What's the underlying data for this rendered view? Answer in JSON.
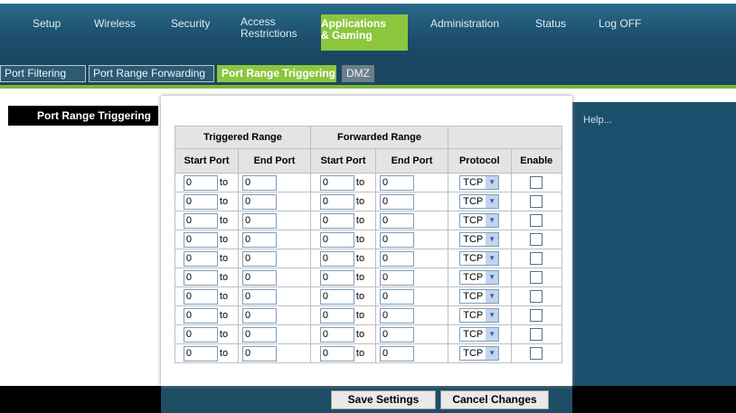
{
  "topnav": {
    "setup": "Setup",
    "wireless": "Wireless",
    "security": "Security",
    "access_line1": "Access",
    "access_line2": "Restrictions",
    "apps_line1": "Applications",
    "apps_line2": "& Gaming",
    "administration": "Administration",
    "status": "Status",
    "logoff": "Log OFF"
  },
  "subtabs": {
    "port_filtering": "Port Filtering",
    "port_range_forwarding": "Port Range Forwarding",
    "port_range_triggering": "Port Range Triggering",
    "dmz": "DMZ"
  },
  "left_header": "Port Range Triggering",
  "help_label": "Help...",
  "table": {
    "group_triggered": "Triggered Range",
    "group_forwarded": "Forwarded Range",
    "col_start": "Start Port",
    "col_end": "End Port",
    "col_protocol": "Protocol",
    "col_enable": "Enable",
    "to_label": "to",
    "rows": [
      {
        "t_start": "0",
        "t_end": "0",
        "f_start": "0",
        "f_end": "0",
        "protocol": "TCP",
        "enabled": false
      },
      {
        "t_start": "0",
        "t_end": "0",
        "f_start": "0",
        "f_end": "0",
        "protocol": "TCP",
        "enabled": false
      },
      {
        "t_start": "0",
        "t_end": "0",
        "f_start": "0",
        "f_end": "0",
        "protocol": "TCP",
        "enabled": false
      },
      {
        "t_start": "0",
        "t_end": "0",
        "f_start": "0",
        "f_end": "0",
        "protocol": "TCP",
        "enabled": false
      },
      {
        "t_start": "0",
        "t_end": "0",
        "f_start": "0",
        "f_end": "0",
        "protocol": "TCP",
        "enabled": false
      },
      {
        "t_start": "0",
        "t_end": "0",
        "f_start": "0",
        "f_end": "0",
        "protocol": "TCP",
        "enabled": false
      },
      {
        "t_start": "0",
        "t_end": "0",
        "f_start": "0",
        "f_end": "0",
        "protocol": "TCP",
        "enabled": false
      },
      {
        "t_start": "0",
        "t_end": "0",
        "f_start": "0",
        "f_end": "0",
        "protocol": "TCP",
        "enabled": false
      },
      {
        "t_start": "0",
        "t_end": "0",
        "f_start": "0",
        "f_end": "0",
        "protocol": "TCP",
        "enabled": false
      },
      {
        "t_start": "0",
        "t_end": "0",
        "f_start": "0",
        "f_end": "0",
        "protocol": "TCP",
        "enabled": false
      }
    ]
  },
  "buttons": {
    "save": "Save Settings",
    "cancel": "Cancel Changes"
  },
  "colors": {
    "nav_bg": "#1c4f6c",
    "accent_green": "#8cc63f"
  }
}
